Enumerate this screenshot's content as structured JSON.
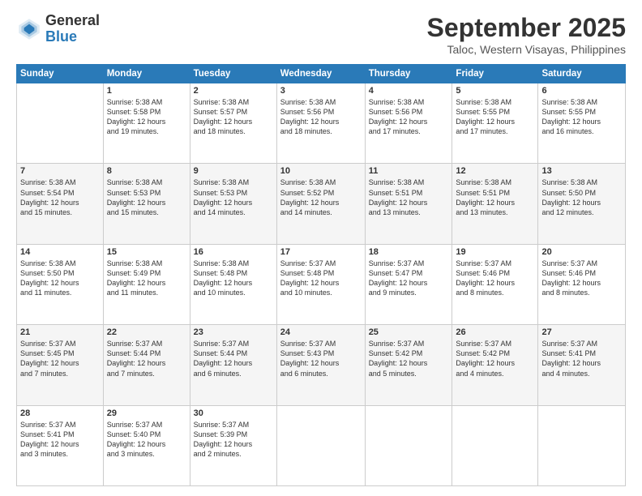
{
  "header": {
    "logo_general": "General",
    "logo_blue": "Blue",
    "month": "September 2025",
    "location": "Taloc, Western Visayas, Philippines"
  },
  "days_of_week": [
    "Sunday",
    "Monday",
    "Tuesday",
    "Wednesday",
    "Thursday",
    "Friday",
    "Saturday"
  ],
  "weeks": [
    [
      {
        "day": "",
        "text": ""
      },
      {
        "day": "1",
        "text": "Sunrise: 5:38 AM\nSunset: 5:58 PM\nDaylight: 12 hours\nand 19 minutes."
      },
      {
        "day": "2",
        "text": "Sunrise: 5:38 AM\nSunset: 5:57 PM\nDaylight: 12 hours\nand 18 minutes."
      },
      {
        "day": "3",
        "text": "Sunrise: 5:38 AM\nSunset: 5:56 PM\nDaylight: 12 hours\nand 18 minutes."
      },
      {
        "day": "4",
        "text": "Sunrise: 5:38 AM\nSunset: 5:56 PM\nDaylight: 12 hours\nand 17 minutes."
      },
      {
        "day": "5",
        "text": "Sunrise: 5:38 AM\nSunset: 5:55 PM\nDaylight: 12 hours\nand 17 minutes."
      },
      {
        "day": "6",
        "text": "Sunrise: 5:38 AM\nSunset: 5:55 PM\nDaylight: 12 hours\nand 16 minutes."
      }
    ],
    [
      {
        "day": "7",
        "text": "Sunrise: 5:38 AM\nSunset: 5:54 PM\nDaylight: 12 hours\nand 15 minutes."
      },
      {
        "day": "8",
        "text": "Sunrise: 5:38 AM\nSunset: 5:53 PM\nDaylight: 12 hours\nand 15 minutes."
      },
      {
        "day": "9",
        "text": "Sunrise: 5:38 AM\nSunset: 5:53 PM\nDaylight: 12 hours\nand 14 minutes."
      },
      {
        "day": "10",
        "text": "Sunrise: 5:38 AM\nSunset: 5:52 PM\nDaylight: 12 hours\nand 14 minutes."
      },
      {
        "day": "11",
        "text": "Sunrise: 5:38 AM\nSunset: 5:51 PM\nDaylight: 12 hours\nand 13 minutes."
      },
      {
        "day": "12",
        "text": "Sunrise: 5:38 AM\nSunset: 5:51 PM\nDaylight: 12 hours\nand 13 minutes."
      },
      {
        "day": "13",
        "text": "Sunrise: 5:38 AM\nSunset: 5:50 PM\nDaylight: 12 hours\nand 12 minutes."
      }
    ],
    [
      {
        "day": "14",
        "text": "Sunrise: 5:38 AM\nSunset: 5:50 PM\nDaylight: 12 hours\nand 11 minutes."
      },
      {
        "day": "15",
        "text": "Sunrise: 5:38 AM\nSunset: 5:49 PM\nDaylight: 12 hours\nand 11 minutes."
      },
      {
        "day": "16",
        "text": "Sunrise: 5:38 AM\nSunset: 5:48 PM\nDaylight: 12 hours\nand 10 minutes."
      },
      {
        "day": "17",
        "text": "Sunrise: 5:37 AM\nSunset: 5:48 PM\nDaylight: 12 hours\nand 10 minutes."
      },
      {
        "day": "18",
        "text": "Sunrise: 5:37 AM\nSunset: 5:47 PM\nDaylight: 12 hours\nand 9 minutes."
      },
      {
        "day": "19",
        "text": "Sunrise: 5:37 AM\nSunset: 5:46 PM\nDaylight: 12 hours\nand 8 minutes."
      },
      {
        "day": "20",
        "text": "Sunrise: 5:37 AM\nSunset: 5:46 PM\nDaylight: 12 hours\nand 8 minutes."
      }
    ],
    [
      {
        "day": "21",
        "text": "Sunrise: 5:37 AM\nSunset: 5:45 PM\nDaylight: 12 hours\nand 7 minutes."
      },
      {
        "day": "22",
        "text": "Sunrise: 5:37 AM\nSunset: 5:44 PM\nDaylight: 12 hours\nand 7 minutes."
      },
      {
        "day": "23",
        "text": "Sunrise: 5:37 AM\nSunset: 5:44 PM\nDaylight: 12 hours\nand 6 minutes."
      },
      {
        "day": "24",
        "text": "Sunrise: 5:37 AM\nSunset: 5:43 PM\nDaylight: 12 hours\nand 6 minutes."
      },
      {
        "day": "25",
        "text": "Sunrise: 5:37 AM\nSunset: 5:42 PM\nDaylight: 12 hours\nand 5 minutes."
      },
      {
        "day": "26",
        "text": "Sunrise: 5:37 AM\nSunset: 5:42 PM\nDaylight: 12 hours\nand 4 minutes."
      },
      {
        "day": "27",
        "text": "Sunrise: 5:37 AM\nSunset: 5:41 PM\nDaylight: 12 hours\nand 4 minutes."
      }
    ],
    [
      {
        "day": "28",
        "text": "Sunrise: 5:37 AM\nSunset: 5:41 PM\nDaylight: 12 hours\nand 3 minutes."
      },
      {
        "day": "29",
        "text": "Sunrise: 5:37 AM\nSunset: 5:40 PM\nDaylight: 12 hours\nand 3 minutes."
      },
      {
        "day": "30",
        "text": "Sunrise: 5:37 AM\nSunset: 5:39 PM\nDaylight: 12 hours\nand 2 minutes."
      },
      {
        "day": "",
        "text": ""
      },
      {
        "day": "",
        "text": ""
      },
      {
        "day": "",
        "text": ""
      },
      {
        "day": "",
        "text": ""
      }
    ]
  ]
}
